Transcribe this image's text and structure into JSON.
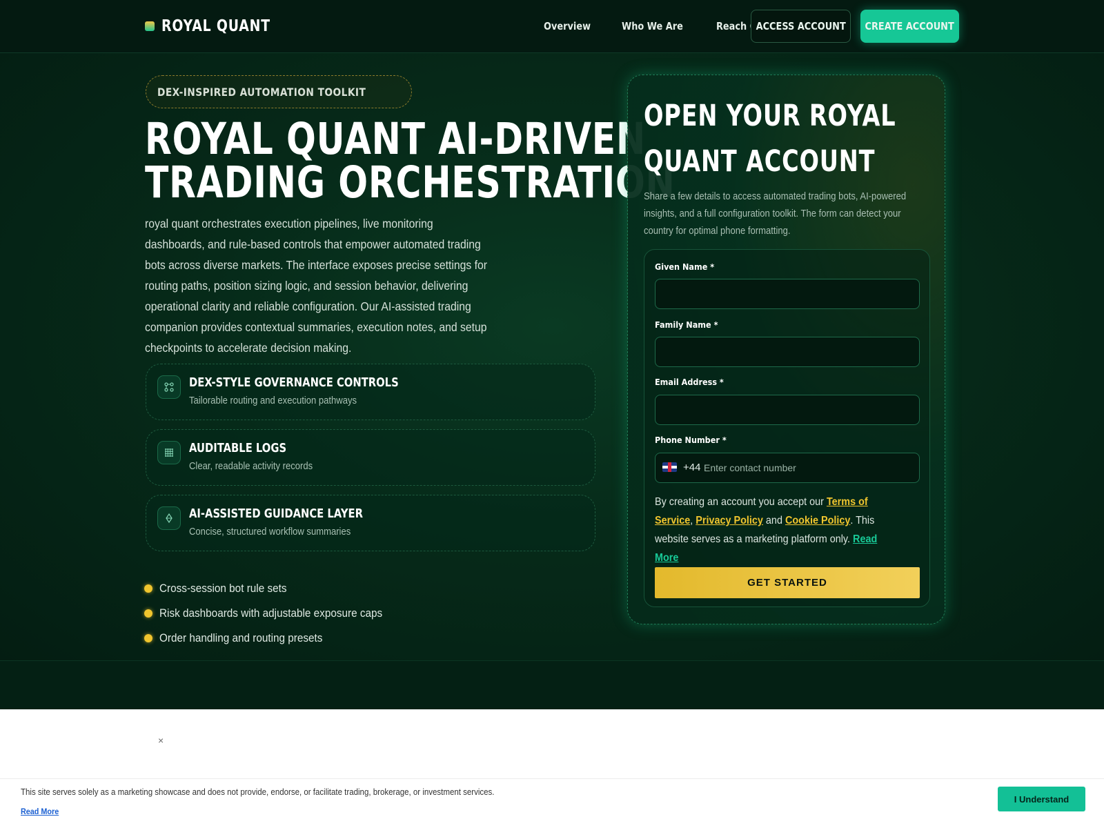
{
  "nav": {
    "brand": "ROYAL QUANT",
    "links": [
      "Overview",
      "Who We Are",
      "Reach Out"
    ],
    "access_label": "ACCESS ACCOUNT",
    "create_label": "CREATE ACCOUNT"
  },
  "hero": {
    "tag": "DEX-INSPIRED AUTOMATION TOOLKIT",
    "title_line1": "ROYAL QUANT AI-DRIVEN",
    "title_line2": "TRADING ORCHESTRATION",
    "description": "royal quant orchestrates execution pipelines, live monitoring dashboards, and rule-based controls that empower automated trading bots across diverse markets. The interface exposes precise settings for routing paths, position sizing logic, and session behavior, delivering operational clarity and reliable configuration. Our AI-assisted trading companion provides contextual summaries, execution notes, and setup checkpoints to accelerate decision making.",
    "features": [
      {
        "icon": "nodes-icon",
        "title": "DEX-STYLE GOVERNANCE CONTROLS",
        "subtitle": "Tailorable routing and execution pathways"
      },
      {
        "icon": "grid-icon",
        "title": "AUDITABLE LOGS",
        "subtitle": "Clear, readable activity records"
      },
      {
        "icon": "diamond-icon",
        "title": "AI-ASSISTED GUIDANCE LAYER",
        "subtitle": "Concise, structured workflow summaries"
      }
    ],
    "bullets": [
      "Cross-session bot rule sets",
      "Risk dashboards with adjustable exposure caps",
      "Order handling and routing presets"
    ]
  },
  "form": {
    "title": "OPEN YOUR ROYAL QUANT ACCOUNT",
    "description": "Share a few details to access automated trading bots, AI-powered insights, and a full configuration toolkit. The form can detect your country for optimal phone formatting.",
    "given_name_label": "Given Name *",
    "family_name_label": "Family Name *",
    "email_label": "Email Address *",
    "phone_label": "Phone Number *",
    "phone_code": "+44",
    "phone_placeholder": "Enter contact number",
    "terms_prefix": "By creating an account you accept our ",
    "terms_link": "Terms of Service",
    "comma": ",",
    "privacy_link": "Privacy Policy",
    "and": " and ",
    "cookie_link": "Cookie Policy",
    "terms_suffix": ". This website serves as a marketing platform only. ",
    "read_more": "Read More",
    "submit_label": "GET STARTED"
  },
  "cookie": {
    "close": "×",
    "text": "This site serves solely as a marketing showcase and does not provide, endorse, or facilitate trading, brokerage, or investment services.",
    "read_more": "Read More",
    "button": "I Understand"
  },
  "colors": {
    "accent_teal": "#16c796",
    "accent_gold": "#f0c52e",
    "background": "#042014"
  }
}
